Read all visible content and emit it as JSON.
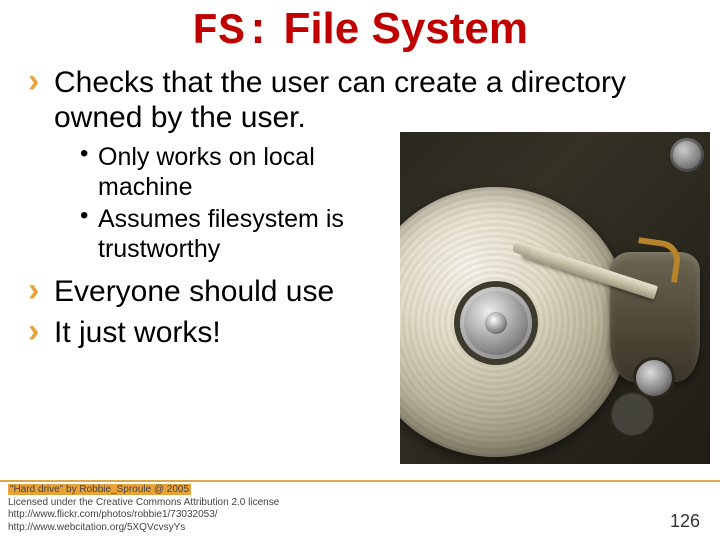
{
  "title": {
    "prefix": "FS:",
    "rest": " File System"
  },
  "bullets": {
    "b1": "Checks that the user can create a directory owned by the user.",
    "sub1": "Only works on local machine",
    "sub2": "Assumes filesystem is trustworthy",
    "b2": "Everyone should use",
    "b3": "It just works!"
  },
  "attribution": {
    "line1": "\"Hard drive\" by Robbie_Sproule @ 2005",
    "line2": "Licensed under the Creative Commons Attribution 2.0 license",
    "line3": "http://www.flickr.com/photos/robbie1/73032053/",
    "line4": "http://www.webcitation.org/5XQVcvsyYs"
  },
  "page_number": "126",
  "image": {
    "alt": "hard-drive-photo"
  }
}
